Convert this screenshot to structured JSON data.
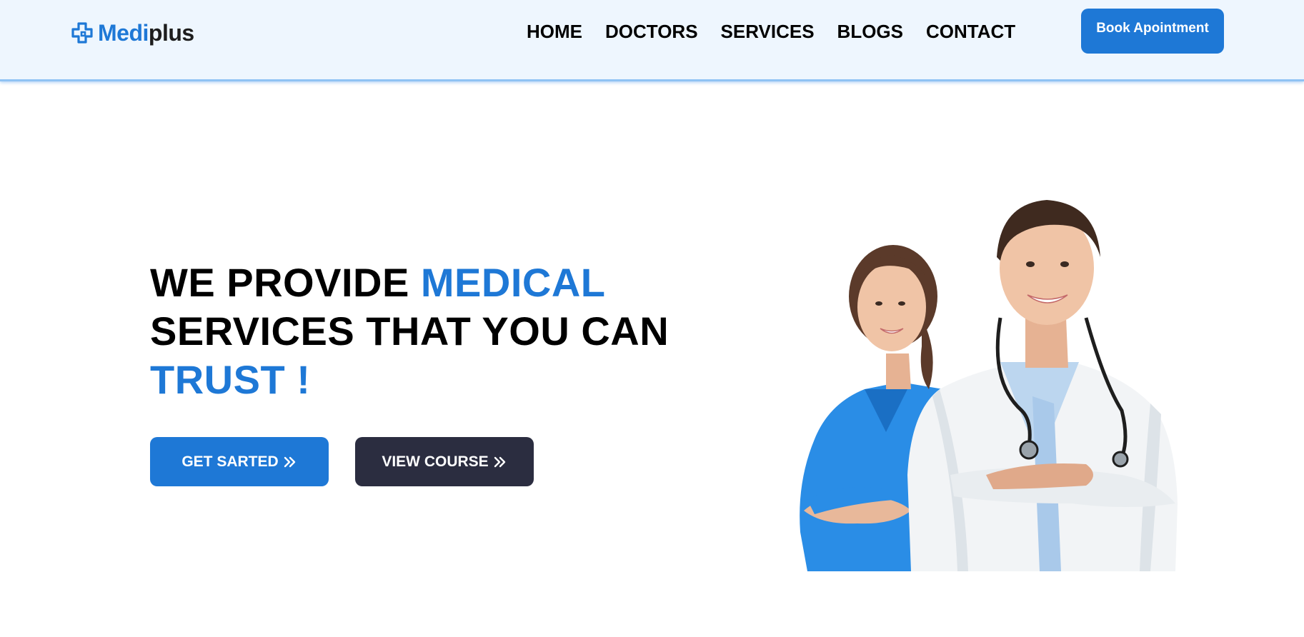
{
  "brand": {
    "name_part1": "Medi",
    "name_part2": "plus",
    "accent_color": "#1e78d6",
    "icon": "medical-cross-icon"
  },
  "nav": {
    "items": [
      {
        "label": "HOME"
      },
      {
        "label": "DOCTORS"
      },
      {
        "label": "SERVICES"
      },
      {
        "label": "BLOGS"
      },
      {
        "label": "CONTACT"
      }
    ],
    "cta_label": "Book Apointment"
  },
  "hero": {
    "title_line1_a": "WE PROVIDE ",
    "title_line1_b": "MEDICAL",
    "title_line2": "SERVICES THAT YOU CAN",
    "title_line3": "TRUST !",
    "primary_button": "GET SARTED",
    "secondary_button": "VIEW COURSE",
    "button_icon": "double-chevron-right-icon",
    "image_subject": "nurse-and-doctor-illustration"
  },
  "colors": {
    "header_bg": "#eef6fe",
    "primary": "#1e78d6",
    "dark": "#2b2d40",
    "text": "#000000"
  }
}
